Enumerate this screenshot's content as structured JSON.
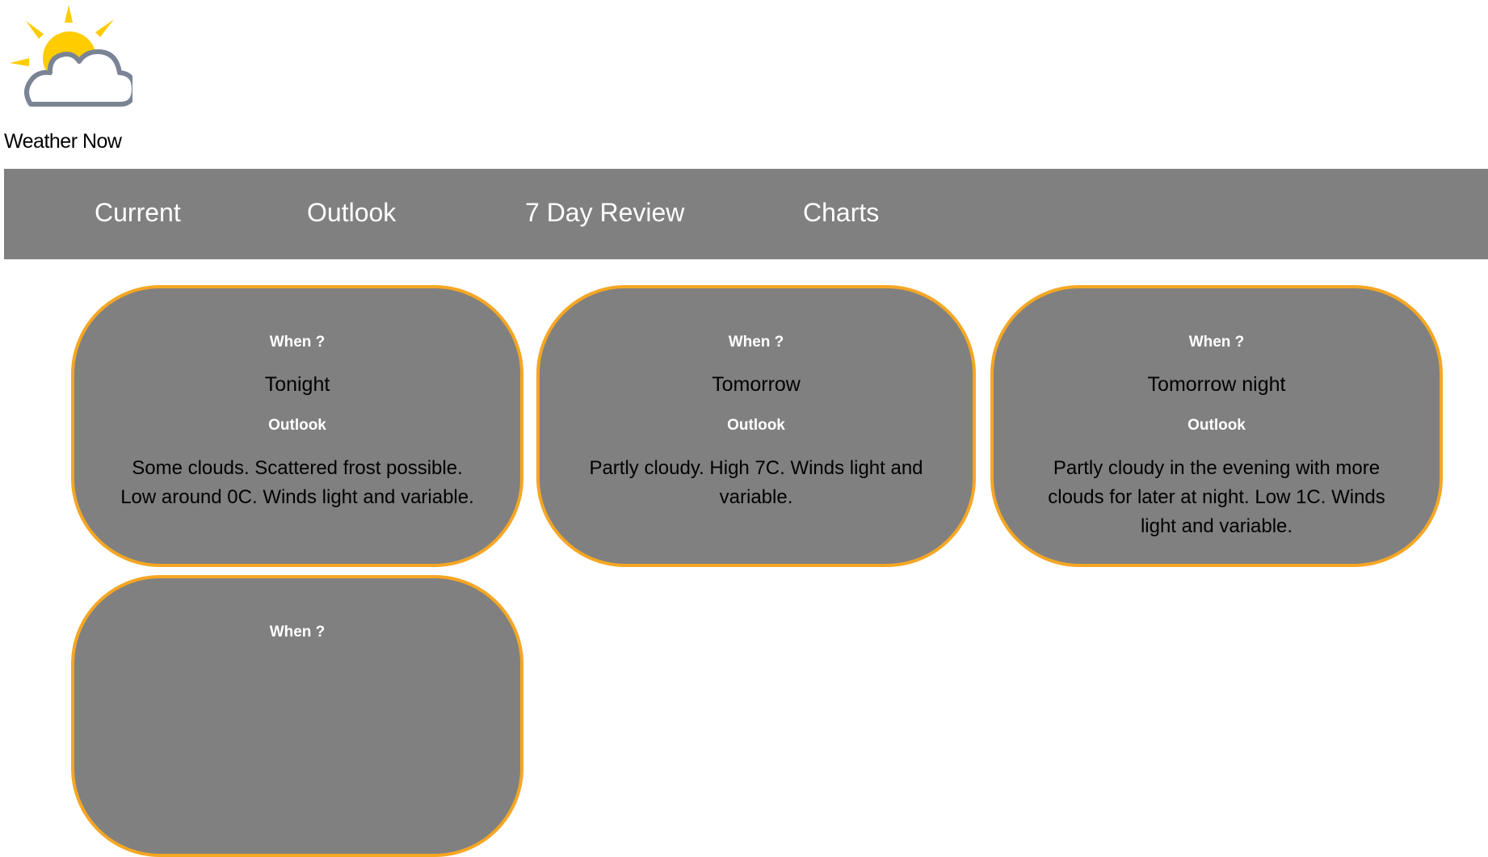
{
  "site": {
    "title": "Weather Now",
    "logo_icon": "partly-cloudy-icon"
  },
  "nav": {
    "items": [
      {
        "label": "Current"
      },
      {
        "label": "Outlook"
      },
      {
        "label": "7 Day Review"
      },
      {
        "label": "Charts"
      }
    ]
  },
  "forecasts": [
    {
      "when_label": "When ?",
      "when": "Tonight",
      "outlook_label": "Outlook",
      "outlook": "Some clouds. Scattered frost possible. Low around 0C. Winds light and variable."
    },
    {
      "when_label": "When ?",
      "when": "Tomorrow",
      "outlook_label": "Outlook",
      "outlook": "Partly cloudy. High 7C. Winds light and variable."
    },
    {
      "when_label": "When ?",
      "when": "Tomorrow night",
      "outlook_label": "Outlook",
      "outlook": "Partly cloudy in the evening with more clouds for later at night. Low 1C. Winds light and variable."
    },
    {
      "when_label": "When ?",
      "when": "",
      "outlook_label": "",
      "outlook": ""
    }
  ],
  "colors": {
    "accent_border": "#f5a623",
    "panel_gray": "#808080",
    "sun_yellow": "#ffcc00",
    "cloud_outline": "#7a8494"
  }
}
